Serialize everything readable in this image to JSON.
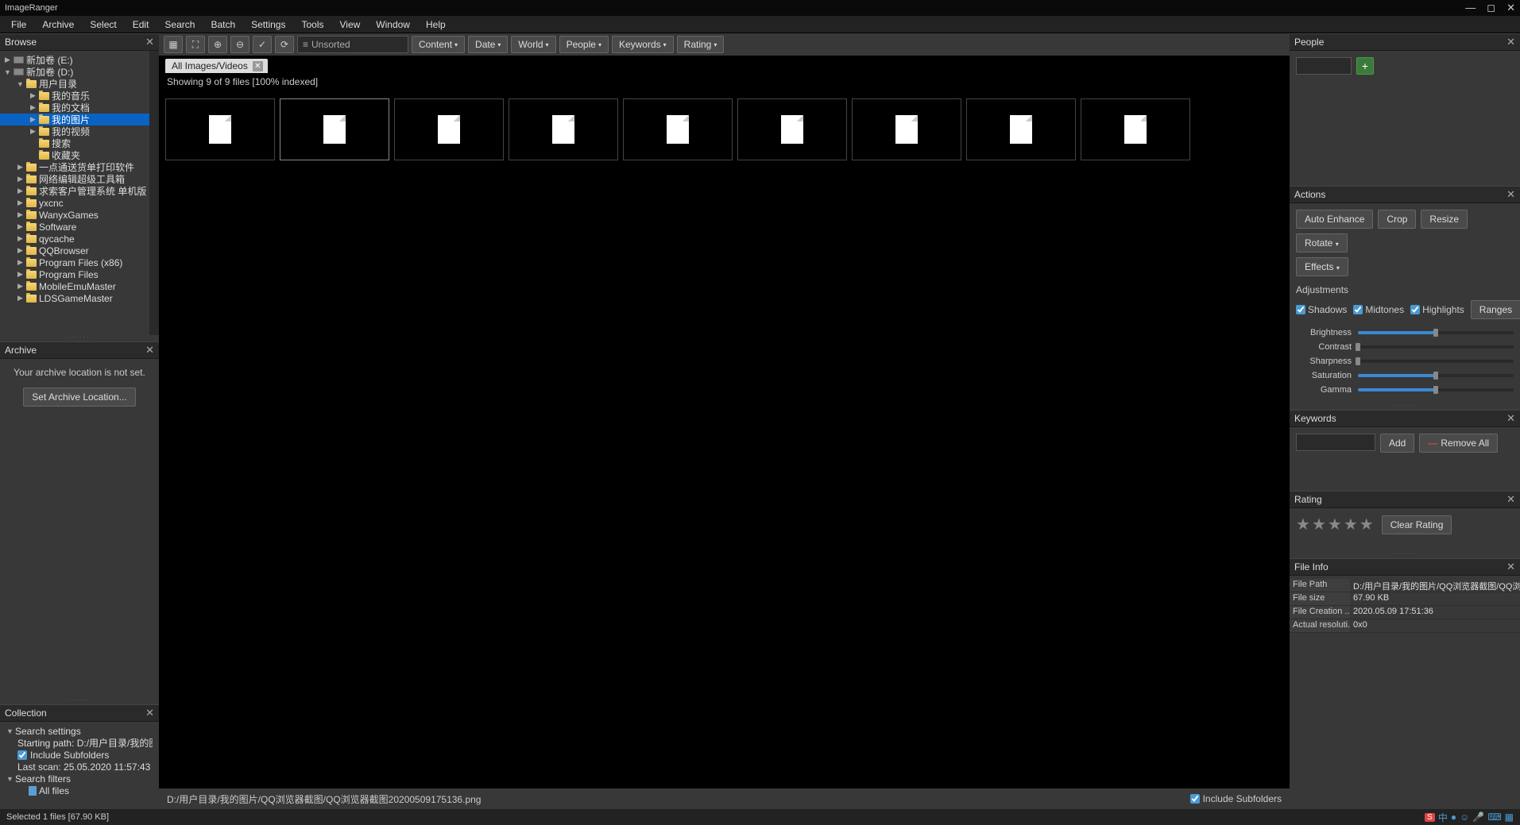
{
  "app_title": "ImageRanger",
  "menu": [
    "File",
    "Archive",
    "Select",
    "Edit",
    "Search",
    "Batch",
    "Settings",
    "Tools",
    "View",
    "Window",
    "Help"
  ],
  "browse": {
    "title": "Browse",
    "tree": [
      {
        "lvl": 0,
        "tw": "▶",
        "ic": "drive",
        "txt": "新加卷 (E:)"
      },
      {
        "lvl": 0,
        "tw": "▼",
        "ic": "drive",
        "txt": "新加卷 (D:)"
      },
      {
        "lvl": 1,
        "tw": "▼",
        "ic": "folder",
        "txt": "用户目录"
      },
      {
        "lvl": 2,
        "tw": "▶",
        "ic": "folder",
        "txt": "我的音乐"
      },
      {
        "lvl": 2,
        "tw": "▶",
        "ic": "folder",
        "txt": "我的文档"
      },
      {
        "lvl": 2,
        "tw": "▶",
        "ic": "folder",
        "txt": "我的图片",
        "sel": true
      },
      {
        "lvl": 2,
        "tw": "▶",
        "ic": "folder",
        "txt": "我的视频"
      },
      {
        "lvl": 2,
        "tw": "",
        "ic": "folder",
        "txt": "搜索"
      },
      {
        "lvl": 2,
        "tw": "",
        "ic": "folder",
        "txt": "收藏夹"
      },
      {
        "lvl": 1,
        "tw": "▶",
        "ic": "folder",
        "txt": "一点通送货单打印软件"
      },
      {
        "lvl": 1,
        "tw": "▶",
        "ic": "folder",
        "txt": "网络编辑超级工具箱"
      },
      {
        "lvl": 1,
        "tw": "▶",
        "ic": "folder",
        "txt": "求索客户管理系统 单机版"
      },
      {
        "lvl": 1,
        "tw": "▶",
        "ic": "folder",
        "txt": "yxcnc"
      },
      {
        "lvl": 1,
        "tw": "▶",
        "ic": "folder",
        "txt": "WanyxGames"
      },
      {
        "lvl": 1,
        "tw": "▶",
        "ic": "folder",
        "txt": "Software"
      },
      {
        "lvl": 1,
        "tw": "▶",
        "ic": "folder",
        "txt": "qycache"
      },
      {
        "lvl": 1,
        "tw": "▶",
        "ic": "folder",
        "txt": "QQBrowser"
      },
      {
        "lvl": 1,
        "tw": "▶",
        "ic": "folder",
        "txt": "Program Files (x86)"
      },
      {
        "lvl": 1,
        "tw": "▶",
        "ic": "folder",
        "txt": "Program Files"
      },
      {
        "lvl": 1,
        "tw": "▶",
        "ic": "folder",
        "txt": "MobileEmuMaster"
      },
      {
        "lvl": 1,
        "tw": "▶",
        "ic": "folder",
        "txt": "LDSGameMaster"
      }
    ]
  },
  "archive": {
    "title": "Archive",
    "msg": "Your archive location is not set.",
    "btn": "Set Archive Location..."
  },
  "collection": {
    "title": "Collection",
    "search_settings": "Search settings",
    "starting_path": "Starting path: D:/用户目录/我的图片",
    "include_sub": "Include Subfolders",
    "last_scan": "Last scan: 25.05.2020 11:57:43",
    "search_filters": "Search filters",
    "all_files": "All files"
  },
  "toolbar": {
    "unsorted": "Unsorted",
    "drops": [
      "Content",
      "Date",
      "World",
      "People",
      "Keywords",
      "Rating"
    ]
  },
  "tab": "All Images/Videos",
  "showing": "Showing 9 of 9 files [100% indexed]",
  "thumb_count": 9,
  "c_footer": {
    "path": "D:/用户目录/我的图片/QQ浏览器截图/QQ浏览器截图20200509175136.png",
    "include": "Include Subfolders"
  },
  "people": {
    "title": "People"
  },
  "actions": {
    "title": "Actions",
    "auto": "Auto Enhance",
    "crop": "Crop",
    "resize": "Resize",
    "rotate": "Rotate",
    "effects": "Effects",
    "adjustments": "Adjustments",
    "shadows": "Shadows",
    "midtones": "Midtones",
    "highlights": "Highlights",
    "ranges": "Ranges",
    "sliders": [
      {
        "lbl": "Brightness",
        "fill": 50
      },
      {
        "lbl": "Contrast",
        "fill": 0
      },
      {
        "lbl": "Sharpness",
        "fill": 0
      },
      {
        "lbl": "Saturation",
        "fill": 50
      },
      {
        "lbl": "Gamma",
        "fill": 50
      }
    ]
  },
  "keywords": {
    "title": "Keywords",
    "add": "Add",
    "remove": "Remove All"
  },
  "rating": {
    "title": "Rating",
    "clear": "Clear Rating"
  },
  "fileinfo": {
    "title": "File Info",
    "rows": [
      {
        "k": "File Path",
        "v": "D:/用户目录/我的图片/QQ浏览器截图/QQ浏览..."
      },
      {
        "k": "File size",
        "v": "67.90 KB"
      },
      {
        "k": "File Creation ...",
        "v": "2020.05.09 17:51:36"
      },
      {
        "k": "Actual resoluti...",
        "v": "0x0"
      }
    ]
  },
  "status": "Selected 1 files [67.90 KB]"
}
